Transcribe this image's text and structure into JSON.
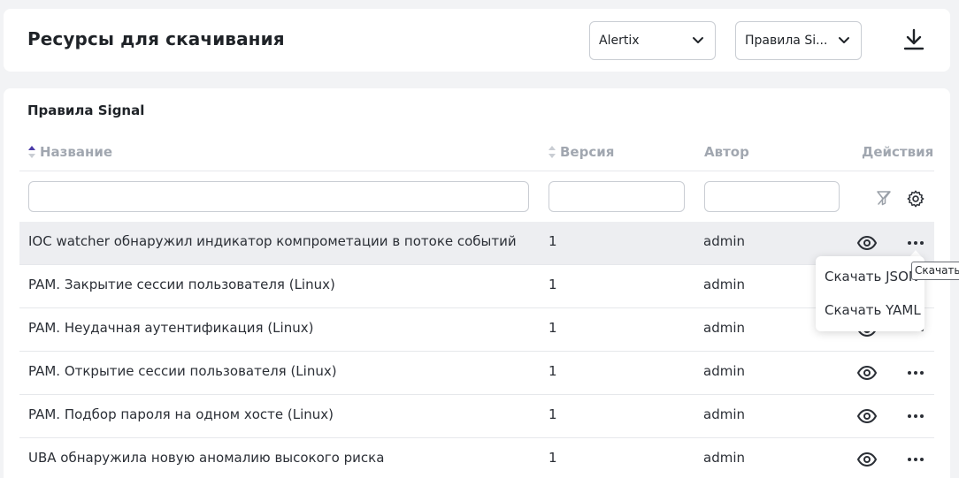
{
  "header": {
    "title": "Ресурсы для скачивания",
    "source_select": {
      "value": "Alertix"
    },
    "type_select": {
      "value": "Правила Si..."
    },
    "download_icon": "download-icon"
  },
  "section": {
    "title": "Правила Signal"
  },
  "table": {
    "columns": {
      "name": "Название",
      "version": "Версия",
      "author": "Автор",
      "actions": "Действия"
    },
    "sorted_column": "name",
    "sort_direction": "asc",
    "filters": {
      "name": "",
      "version": "",
      "author": ""
    },
    "rows": [
      {
        "name": "IOC watcher обнаружил индикатор компрометации в потоке событий",
        "version": "1",
        "author": "admin"
      },
      {
        "name": "PAM. Закрытие сессии пользователя (Linux)",
        "version": "1",
        "author": "admin"
      },
      {
        "name": "PAM. Неудачная аутентификация (Linux)",
        "version": "1",
        "author": "admin"
      },
      {
        "name": "PAM. Открытие сессии пользователя (Linux)",
        "version": "1",
        "author": "admin"
      },
      {
        "name": "PAM. Подбор пароля на одном хосте (Linux)",
        "version": "1",
        "author": "admin"
      },
      {
        "name": "UBA обнаружила новую аномалию высокого риска",
        "version": "1",
        "author": "admin"
      }
    ]
  },
  "dropdown": {
    "items": [
      "Скачать JSON",
      "Скачать YAML"
    ]
  },
  "tooltip": {
    "text": "Скачать"
  },
  "colors": {
    "accent": "#4a3aa8",
    "muted_header": "#a1a7b0",
    "row_highlight": "#edeef1"
  }
}
